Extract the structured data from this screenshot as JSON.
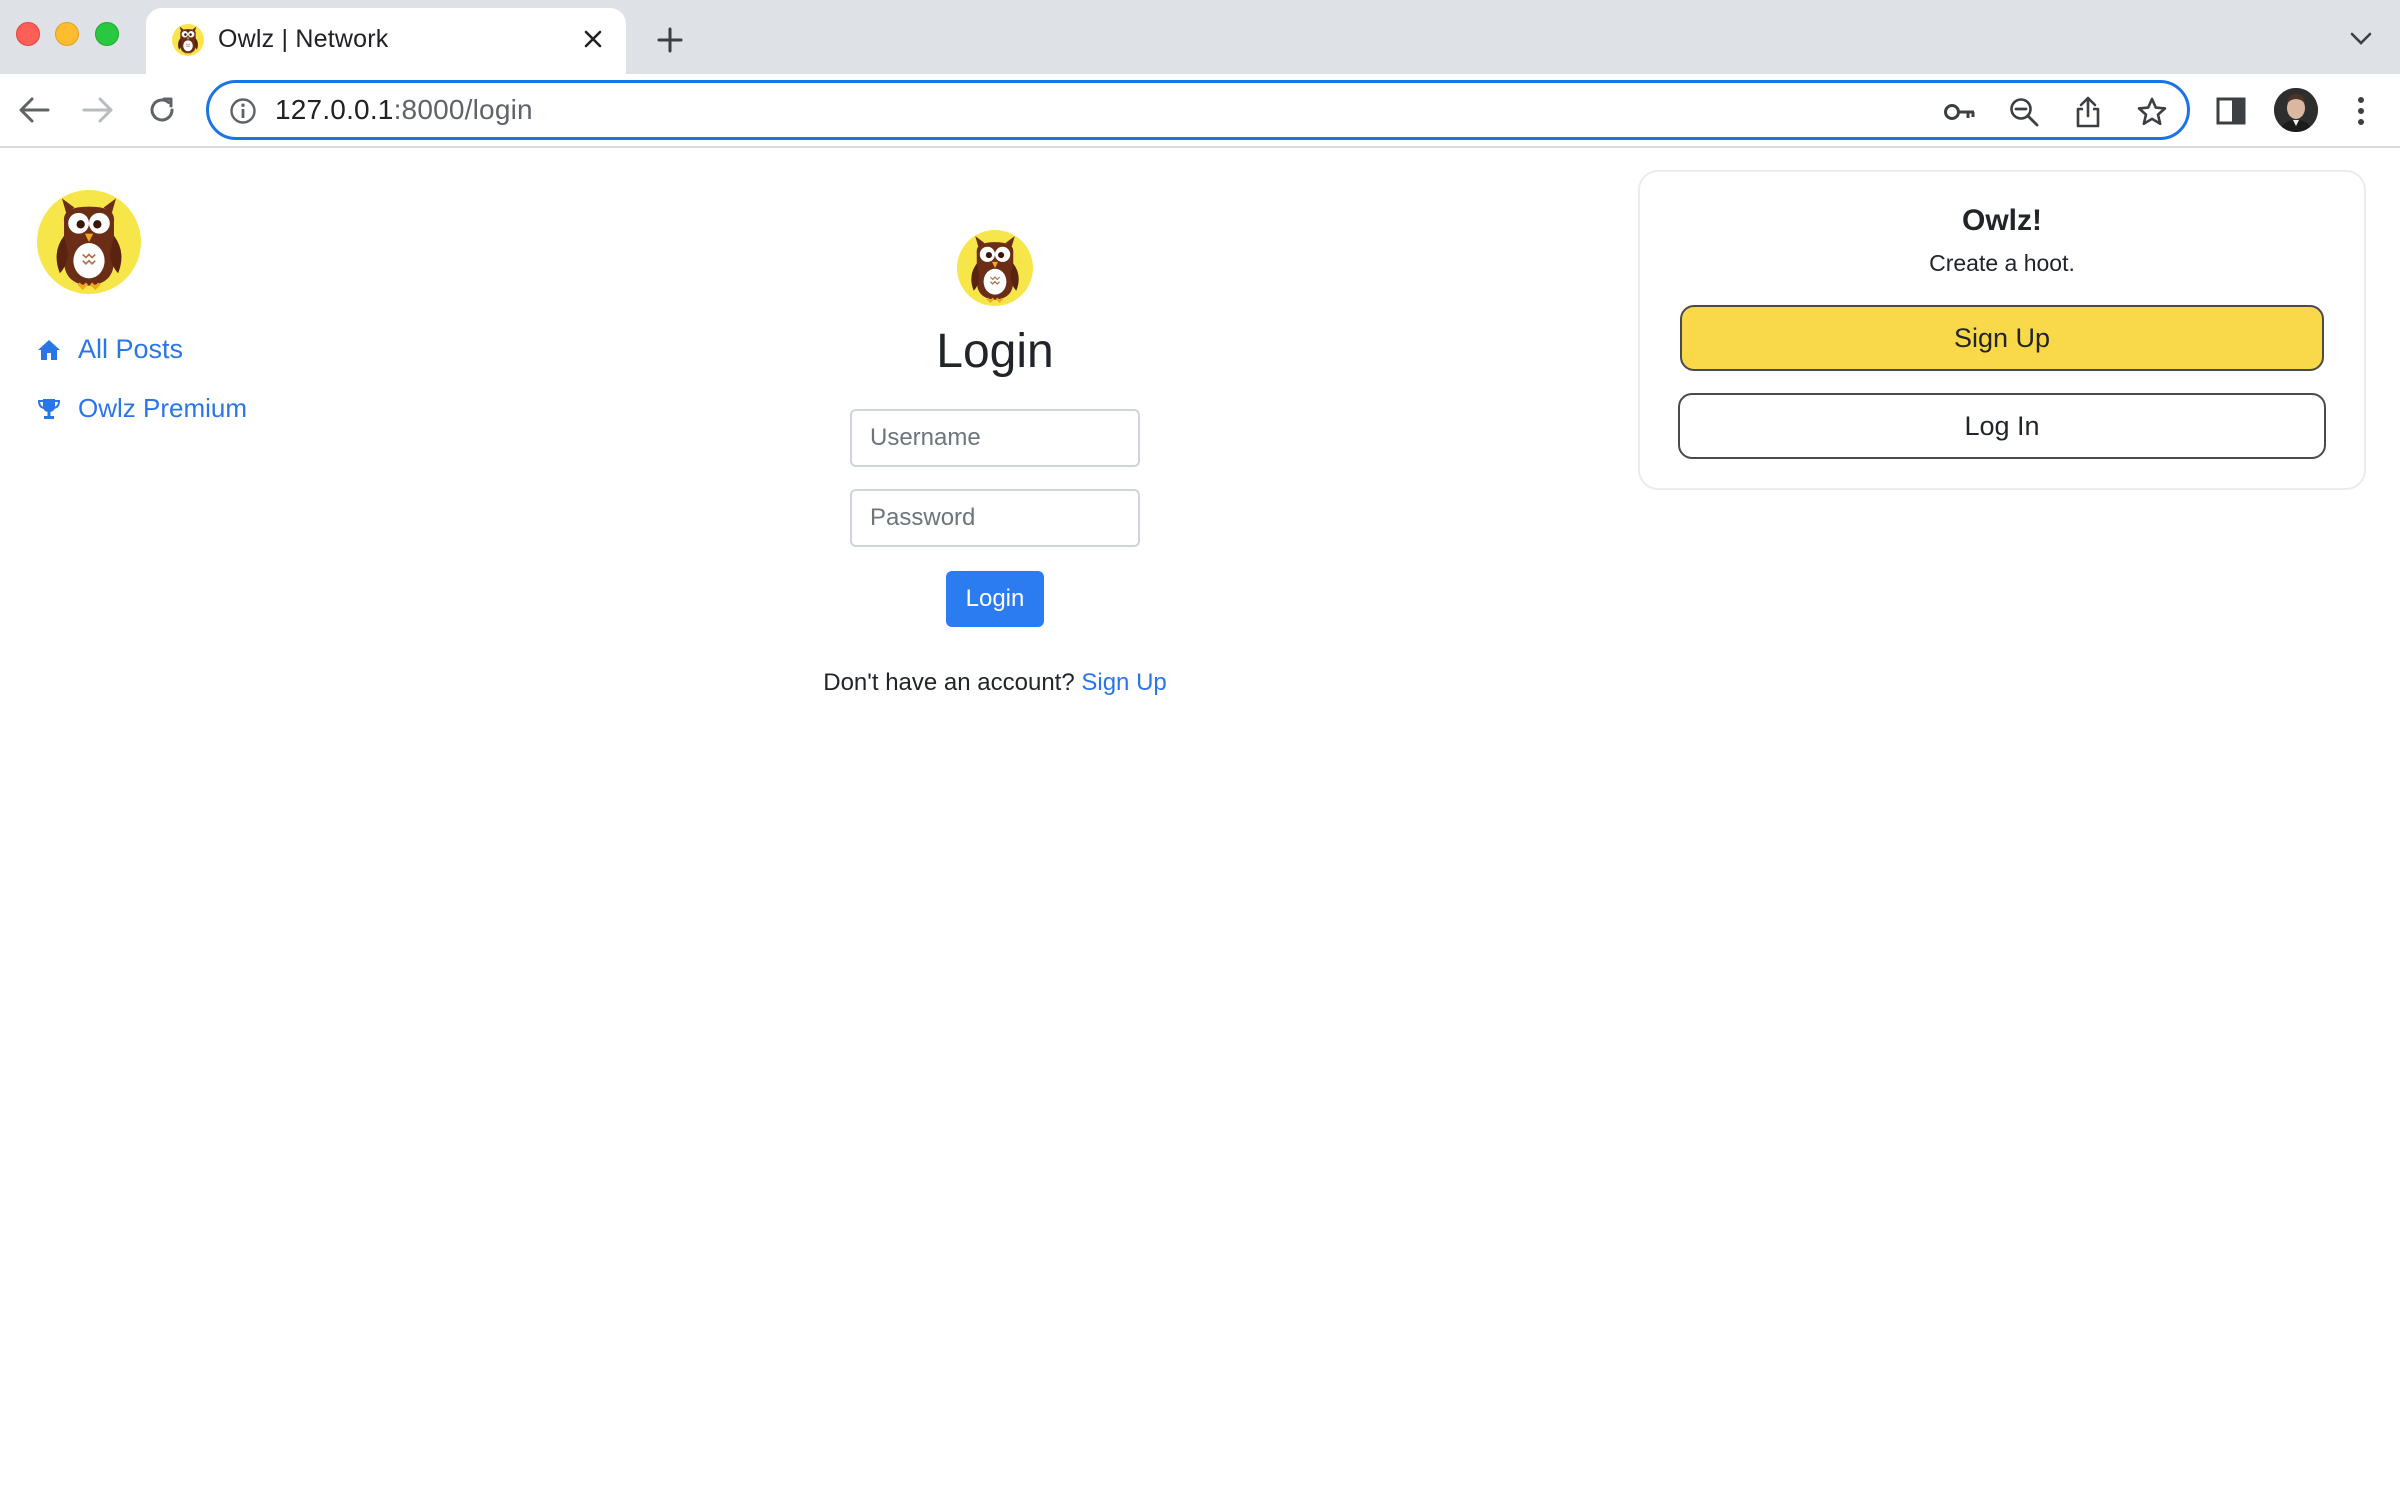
{
  "browser": {
    "tab_title": "Owlz | Network",
    "url_host": "127.0.0.1",
    "url_rest": ":8000/login",
    "favicon": "owl-icon"
  },
  "sidebar": {
    "logo": "owl-logo",
    "items": [
      {
        "label": "All Posts",
        "icon": "home-icon"
      },
      {
        "label": "Owlz Premium",
        "icon": "trophy-icon"
      }
    ]
  },
  "login": {
    "title": "Login",
    "username_placeholder": "Username",
    "password_placeholder": "Password",
    "submit_label": "Login",
    "no_account_text": "Don't have an account?",
    "signup_link": "Sign Up"
  },
  "card": {
    "title": "Owlz!",
    "subtitle": "Create a hoot.",
    "signup_label": "Sign Up",
    "login_label": "Log In"
  },
  "colors": {
    "accent": "#2a7cf0",
    "link": "#2a76e8",
    "brand_yellow": "#f9d84a",
    "owl_brown": "#6b2d16"
  }
}
